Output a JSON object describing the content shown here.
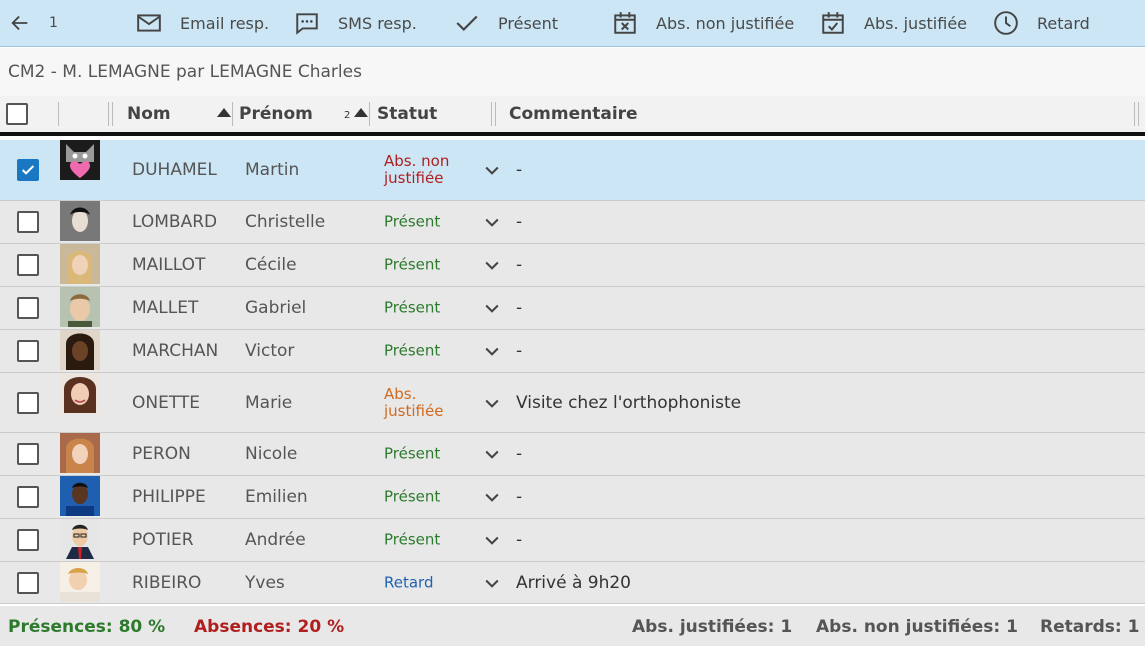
{
  "toolbar": {
    "back_count": "1",
    "buttons": [
      {
        "label": "Email resp.",
        "icon": "email-icon"
      },
      {
        "label": "SMS resp.",
        "icon": "sms-icon"
      },
      {
        "label": "Présent",
        "icon": "check-icon"
      },
      {
        "label": "Abs. non justifiée",
        "icon": "calendar-x-icon"
      },
      {
        "label": "Abs. justifiée",
        "icon": "calendar-check-icon"
      },
      {
        "label": "Retard",
        "icon": "clock-icon"
      }
    ]
  },
  "subtitle": "CM2 - M. LEMAGNE par LEMAGNE Charles",
  "columns": {
    "nom": "Nom",
    "prenom": "Prénom",
    "prenom_sort_index": "2",
    "statut": "Statut",
    "commentaire": "Commentaire"
  },
  "students": [
    {
      "nom": "DUHAMEL",
      "prenom": "Martin",
      "statut": "Abs. non justifiée",
      "status_key": "nonjust",
      "comment": "-",
      "checked": true
    },
    {
      "nom": "LOMBARD",
      "prenom": "Christelle",
      "statut": "Présent",
      "status_key": "present",
      "comment": "-",
      "checked": false
    },
    {
      "nom": "MAILLOT",
      "prenom": "Cécile",
      "statut": "Présent",
      "status_key": "present",
      "comment": "-",
      "checked": false
    },
    {
      "nom": "MALLET",
      "prenom": "Gabriel",
      "statut": "Présent",
      "status_key": "present",
      "comment": "-",
      "checked": false
    },
    {
      "nom": "MARCHAN",
      "prenom": "Victor",
      "statut": "Présent",
      "status_key": "present",
      "comment": "-",
      "checked": false
    },
    {
      "nom": "ONETTE",
      "prenom": "Marie",
      "statut": "Abs. justifiée",
      "status_key": "just",
      "comment": "Visite chez l'orthophoniste",
      "checked": false
    },
    {
      "nom": "PERON",
      "prenom": "Nicole",
      "statut": "Présent",
      "status_key": "present",
      "comment": "-",
      "checked": false
    },
    {
      "nom": "PHILIPPE",
      "prenom": "Emilien",
      "statut": "Présent",
      "status_key": "present",
      "comment": "-",
      "checked": false
    },
    {
      "nom": "POTIER",
      "prenom": "Andrée",
      "statut": "Présent",
      "status_key": "present",
      "comment": "-",
      "checked": false
    },
    {
      "nom": "RIBEIRO",
      "prenom": "Yves",
      "statut": "Retard",
      "status_key": "retard",
      "comment": "Arrivé à 9h20",
      "checked": false
    }
  ],
  "footer": {
    "presences": "Présences: 80 %",
    "absences": "Absences: 20 %",
    "abs_justifiees": "Abs. justifiées: 1",
    "abs_non_justifiees": "Abs. non justifiées: 1",
    "retards": "Retards: 1"
  },
  "colors": {
    "toolbar_bg": "#cce6f5",
    "present": "#2d7a2d",
    "absent_unjustified": "#b01f1f",
    "absent_justified": "#d06a20",
    "late": "#1f62b0",
    "checkbox_checked": "#1a78c2"
  }
}
